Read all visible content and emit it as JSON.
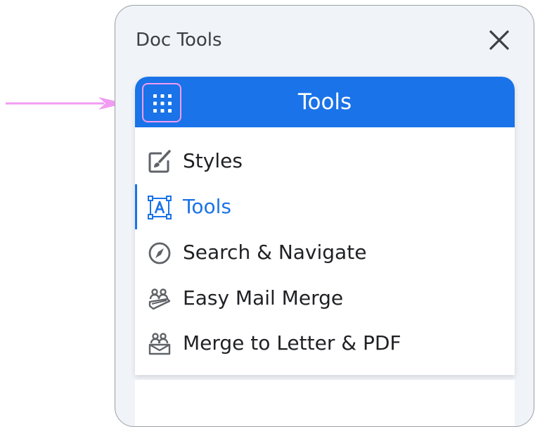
{
  "panel": {
    "title": "Doc Tools"
  },
  "menu": {
    "header_title": "Tools",
    "items": [
      {
        "label": "Styles",
        "icon": "brush-edit-icon",
        "active": false
      },
      {
        "label": "Tools",
        "icon": "text-box-icon",
        "active": true
      },
      {
        "label": "Search & Navigate",
        "icon": "compass-icon",
        "active": false
      },
      {
        "label": "Easy Mail Merge",
        "icon": "mail-merge-icon",
        "active": false
      },
      {
        "label": "Merge to Letter & PDF",
        "icon": "letter-merge-icon",
        "active": false
      }
    ]
  },
  "colors": {
    "accent": "#1a73e8",
    "panel_bg": "#f0f3f8",
    "annotation": "#f29bf2",
    "text": "#202124"
  }
}
